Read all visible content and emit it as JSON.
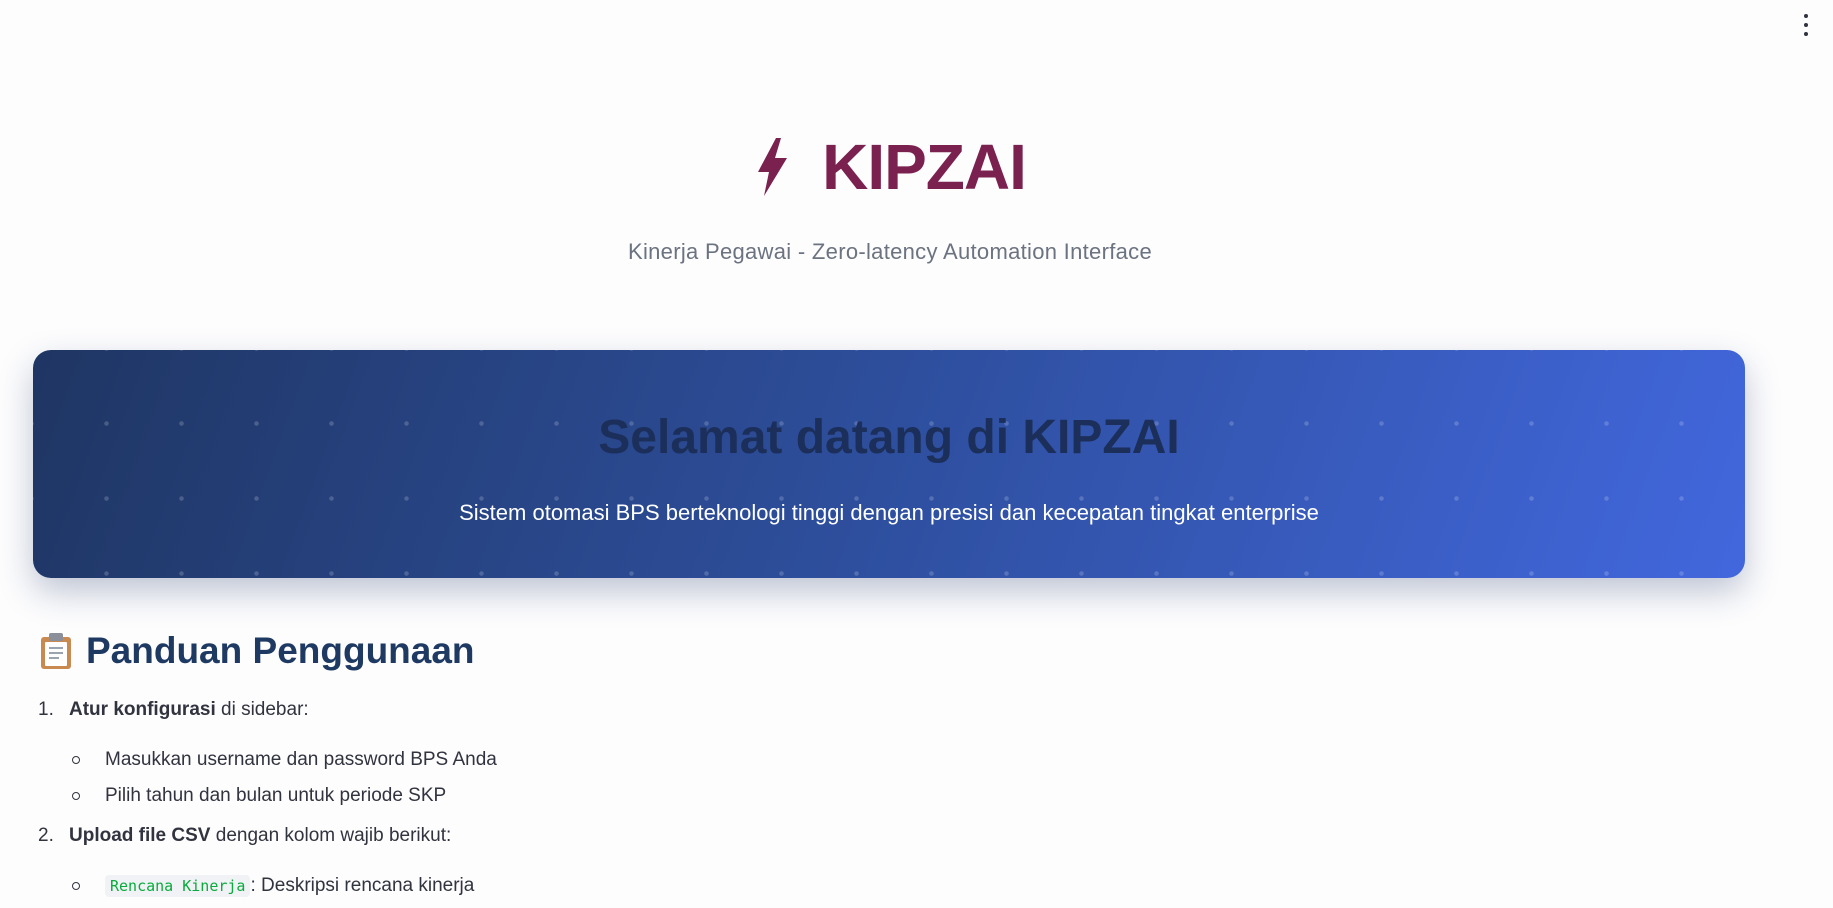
{
  "menu": {
    "icon": "more-vertical-icon"
  },
  "hero": {
    "icon": "lightning-bolt-icon",
    "title": "KIPZAI",
    "subtitle": "Kinerja Pegawai - Zero-latency Automation Interface",
    "accent_color": "#7b2150"
  },
  "banner": {
    "title": "Selamat datang di KIPZAI",
    "text": "Sistem otomasi BPS berteknologi tinggi dengan presisi dan kecepatan tingkat enterprise"
  },
  "guide": {
    "icon": "clipboard-icon",
    "heading": "Panduan Penggunaan",
    "steps": [
      {
        "number": "1.",
        "bold": "Atur konfigurasi",
        "rest": " di sidebar:",
        "subitems": [
          "Masukkan username dan password BPS Anda",
          "Pilih tahun dan bulan untuk periode SKP"
        ]
      },
      {
        "number": "2.",
        "bold": "Upload file CSV",
        "rest": " dengan kolom wajib berikut:",
        "subitems": [
          {
            "code": "Rencana Kinerja",
            "text": ": Deskripsi rencana kinerja"
          }
        ]
      }
    ]
  }
}
